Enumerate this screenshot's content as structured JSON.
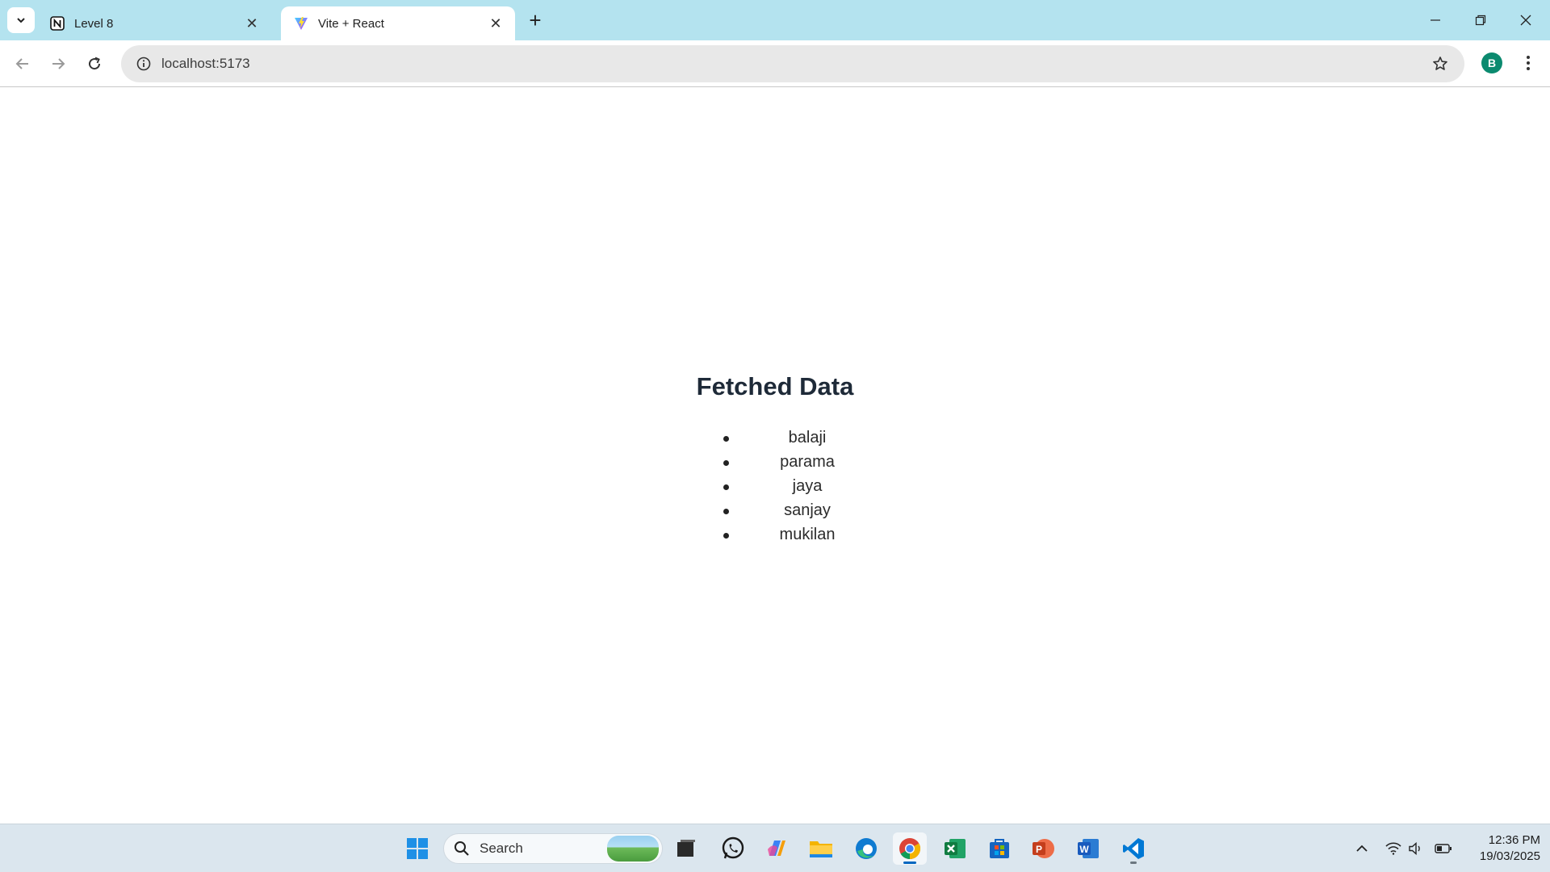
{
  "browser": {
    "tabs": [
      {
        "title": "Level 8",
        "favicon": "notion-icon",
        "active": false
      },
      {
        "title": "Vite + React",
        "favicon": "vite-icon",
        "active": true
      }
    ],
    "address": {
      "url": "localhost:5173"
    },
    "profile_initial": "B",
    "colors": {
      "tabstrip": "#b4e3ef",
      "profile": "#0b8a6f"
    }
  },
  "page": {
    "heading": "Fetched Data",
    "items": [
      "balaji",
      "parama",
      "jaya",
      "sanjay",
      "mukilan"
    ]
  },
  "taskbar": {
    "search_label": "Search",
    "apps": [
      "windows-start",
      "file-explorer-alt",
      "whatsapp",
      "copilot",
      "file-explorer",
      "edge",
      "chrome",
      "excel",
      "microsoft-store",
      "powerpoint",
      "word",
      "vscode"
    ],
    "clock": {
      "time": "12:36 PM",
      "date": "19/03/2025"
    }
  }
}
